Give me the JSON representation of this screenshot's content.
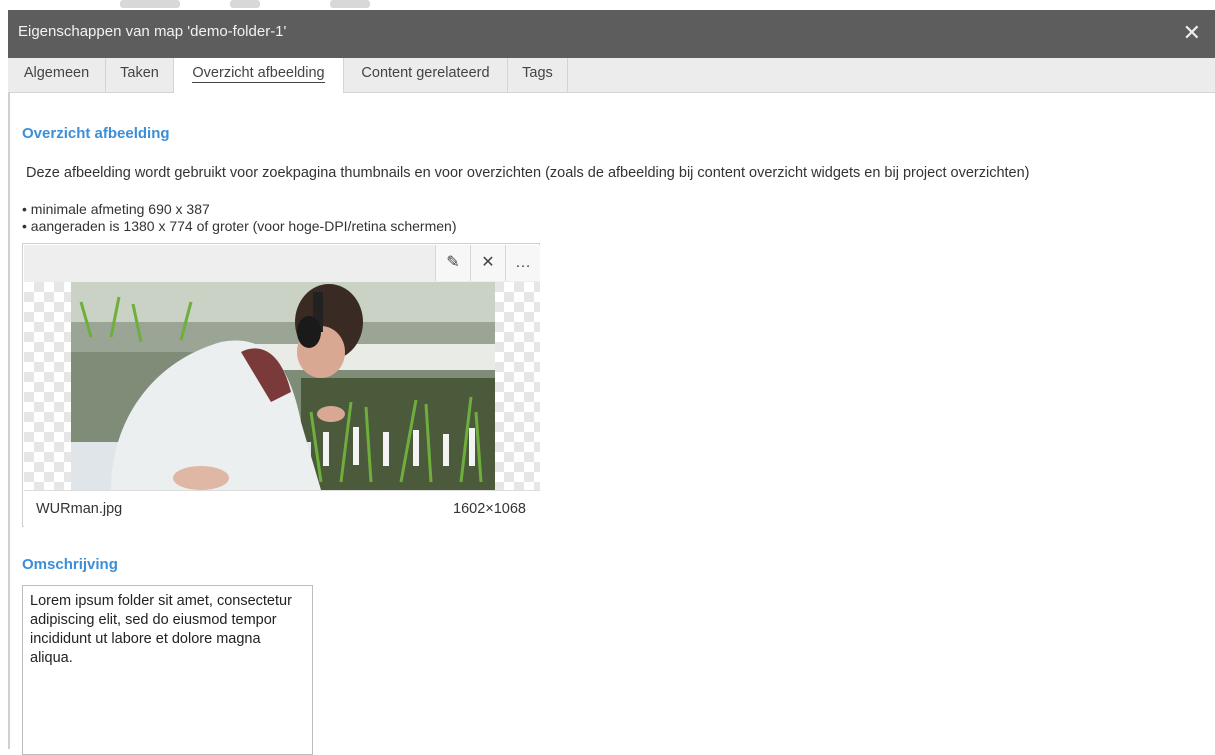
{
  "dialog": {
    "title": "Eigenschappen van map 'demo-folder-1'",
    "close_symbol": "✕"
  },
  "tabs": [
    {
      "label": "Algemeen",
      "active": false
    },
    {
      "label": "Taken",
      "active": false
    },
    {
      "label": "Overzicht afbeelding",
      "active": true
    },
    {
      "label": "Content gerelateerd",
      "active": false
    },
    {
      "label": "Tags",
      "active": false
    }
  ],
  "overview": {
    "heading": "Overzicht afbeelding",
    "description": "Deze afbeelding wordt gebruikt voor zoekpagina thumbnails en voor overzichten (zoals de afbeelding bij content overzicht widgets en bij project overzichten)",
    "bullets": [
      "• minimale afmeting 690 x 387",
      "• aangeraden is 1380 x 774 of groter (voor hoge-DPI/retina schermen)"
    ]
  },
  "image": {
    "filename": "WURman.jpg",
    "dimensions": "1602×1068",
    "tools": [
      {
        "icon": "pencil-icon",
        "glyph": "✎"
      },
      {
        "icon": "close-icon",
        "glyph": "✕"
      },
      {
        "icon": "more-icon",
        "glyph": "…"
      }
    ]
  },
  "description_section": {
    "heading": "Omschrijving",
    "value": "Lorem ipsum folder sit amet, consectetur adipiscing elit, sed do eiusmod tempor incididunt ut labore et dolore magna aliqua."
  },
  "colors": {
    "accent": "#3b8fd9",
    "titlebar": "#5d5d5d",
    "tabbar": "#ececec"
  }
}
